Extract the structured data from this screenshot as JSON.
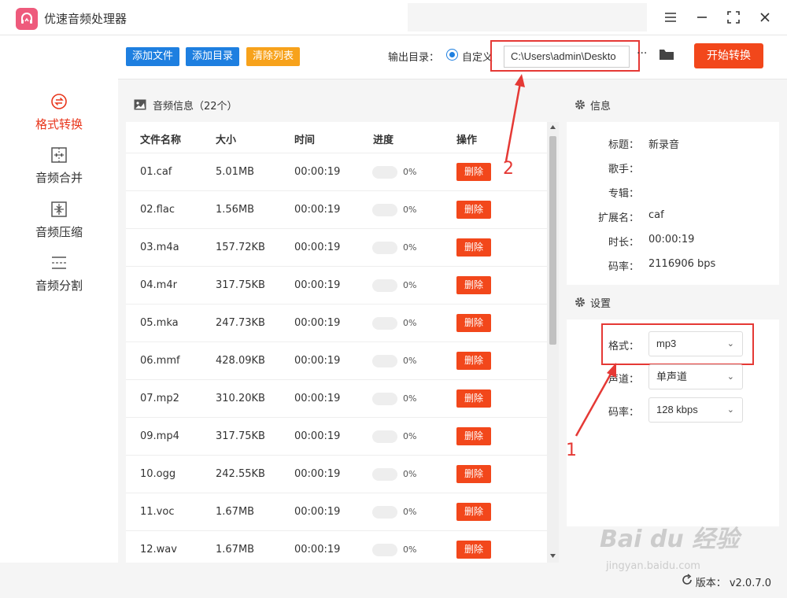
{
  "app": {
    "title": "优速音频处理器"
  },
  "colors": {
    "accent": "#f2471b",
    "primary_blue": "#1e7fe0",
    "clear_button": "#f7a21b",
    "annotation_red": "#e53935"
  },
  "sidebar": {
    "items": [
      {
        "label": "格式转换",
        "icon": "format-convert-icon",
        "active": true
      },
      {
        "label": "音频合并",
        "icon": "merge-icon",
        "active": false
      },
      {
        "label": "音频压缩",
        "icon": "compress-icon",
        "active": false
      },
      {
        "label": "音频分割",
        "icon": "split-icon",
        "active": false
      }
    ]
  },
  "toolbar": {
    "add_file": "添加文件",
    "add_dir": "添加目录",
    "clear_list": "清除列表",
    "output_label": "输出目录：",
    "custom_label": "自定义",
    "output_path": "C:\\Users\\admin\\Deskto",
    "more": "···",
    "start": "开始转换"
  },
  "list": {
    "header": "音频信息（22个）",
    "columns": [
      "文件名称",
      "大小",
      "时间",
      "进度",
      "操作"
    ],
    "delete_label": "删除",
    "rows": [
      {
        "name": "01.caf",
        "size": "5.01MB",
        "time": "00:00:19",
        "progress": "0%"
      },
      {
        "name": "02.flac",
        "size": "1.56MB",
        "time": "00:00:19",
        "progress": "0%"
      },
      {
        "name": "03.m4a",
        "size": "157.72KB",
        "time": "00:00:19",
        "progress": "0%"
      },
      {
        "name": "04.m4r",
        "size": "317.75KB",
        "time": "00:00:19",
        "progress": "0%"
      },
      {
        "name": "05.mka",
        "size": "247.73KB",
        "time": "00:00:19",
        "progress": "0%"
      },
      {
        "name": "06.mmf",
        "size": "428.09KB",
        "time": "00:00:19",
        "progress": "0%"
      },
      {
        "name": "07.mp2",
        "size": "310.20KB",
        "time": "00:00:19",
        "progress": "0%"
      },
      {
        "name": "09.mp4",
        "size": "317.75KB",
        "time": "00:00:19",
        "progress": "0%"
      },
      {
        "name": "10.ogg",
        "size": "242.55KB",
        "time": "00:00:19",
        "progress": "0%"
      },
      {
        "name": "11.voc",
        "size": "1.67MB",
        "time": "00:00:19",
        "progress": "0%"
      },
      {
        "name": "12.wav",
        "size": "1.67MB",
        "time": "00:00:19",
        "progress": "0%"
      }
    ]
  },
  "info": {
    "header": "信息",
    "fields": [
      {
        "key": "标题：",
        "value": "新录音"
      },
      {
        "key": "歌手：",
        "value": ""
      },
      {
        "key": "专辑：",
        "value": ""
      },
      {
        "key": "扩展名：",
        "value": "caf"
      },
      {
        "key": "时长：",
        "value": "00:00:19"
      },
      {
        "key": "码率：",
        "value": "2116906 bps"
      }
    ]
  },
  "settings": {
    "header": "设置",
    "format_label": "格式：",
    "format_value": "mp3",
    "channel_label": "声道：",
    "channel_value": "单声道",
    "bitrate_label": "码率：",
    "bitrate_value": "128 kbps"
  },
  "status": {
    "version": "版本：  v2.0.7.0"
  },
  "annotations": {
    "one": "1",
    "two": "2"
  },
  "watermark": {
    "main": "Bai du 经验",
    "sub": "jingyan.baidu.com"
  }
}
